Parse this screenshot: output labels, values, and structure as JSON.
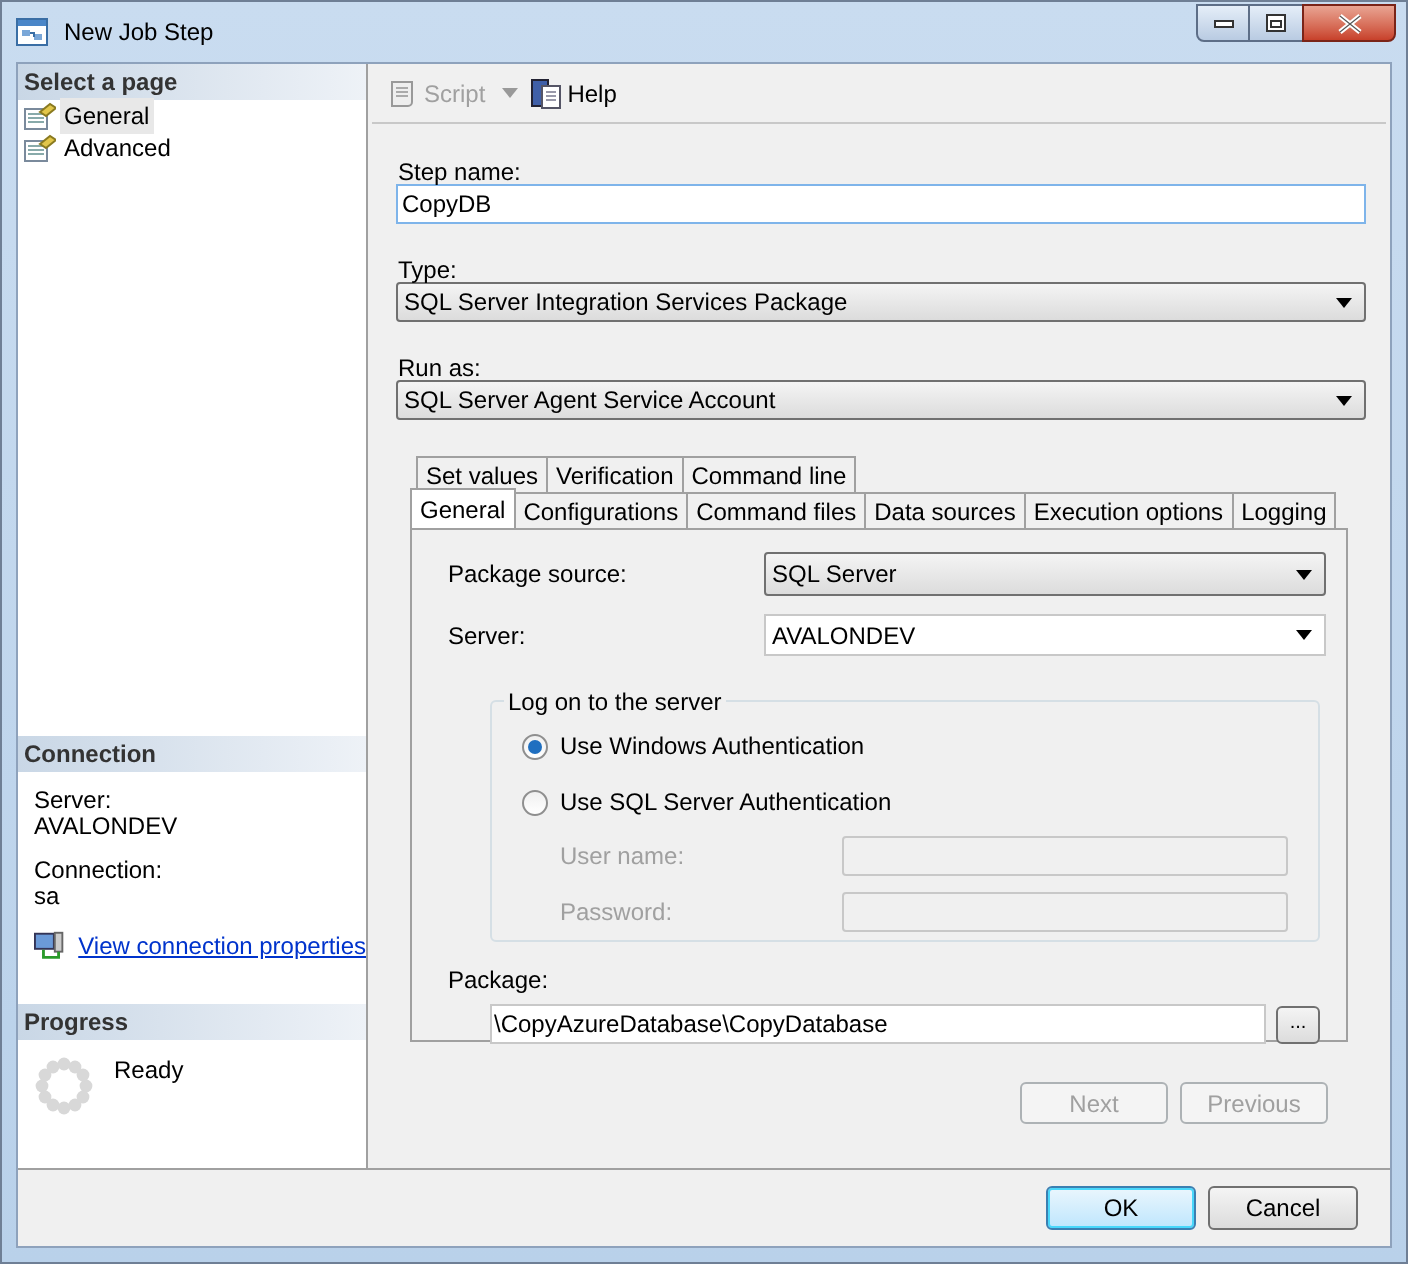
{
  "window": {
    "title": "New Job Step"
  },
  "sidebar": {
    "select_page": {
      "header": "Select a page",
      "items": [
        {
          "label": "General",
          "selected": true
        },
        {
          "label": "Advanced",
          "selected": false
        }
      ]
    },
    "connection": {
      "header": "Connection",
      "fields": [
        {
          "label": "Server:",
          "value": "AVALONDEV"
        },
        {
          "label": "Connection:",
          "value": "sa"
        }
      ],
      "link": "View connection properties"
    },
    "progress": {
      "header": "Progress",
      "status": "Ready"
    }
  },
  "toolbar": [
    {
      "label": "Script",
      "kind": "dropdown",
      "disabled": true
    },
    {
      "label": "Help",
      "kind": "button",
      "disabled": false
    }
  ],
  "form": {
    "step_name": {
      "label": "Step name:",
      "value": "CopyDB"
    },
    "type": {
      "label": "Type:",
      "value": "SQL Server Integration Services Package"
    },
    "run_as": {
      "label": "Run as:",
      "value": "SQL Server Agent Service Account"
    }
  },
  "tabs": [
    [
      {
        "label": "Set values",
        "selected": false
      },
      {
        "label": "Verification",
        "selected": false
      },
      {
        "label": "Command line",
        "selected": false
      }
    ],
    [
      {
        "label": "General",
        "selected": true
      },
      {
        "label": "Configurations",
        "selected": false
      },
      {
        "label": "Command files",
        "selected": false
      },
      {
        "label": "Data sources",
        "selected": false
      },
      {
        "label": "Execution options",
        "selected": false
      },
      {
        "label": "Logging",
        "selected": false
      }
    ]
  ],
  "general_tab": {
    "package_source": {
      "label": "Package source:",
      "value": "SQL Server"
    },
    "server": {
      "label": "Server:",
      "value": "AVALONDEV"
    },
    "logon": {
      "title": "Log on to the server",
      "options": [
        {
          "label": "Use Windows Authentication",
          "selected": true
        },
        {
          "label": "Use SQL Server Authentication",
          "selected": false
        }
      ],
      "credentials": [
        {
          "label": "User name:",
          "disabled": true
        },
        {
          "label": "Password:",
          "disabled": true
        }
      ]
    },
    "package": {
      "label": "Package:",
      "value": "\\CopyAzureDatabase\\CopyDatabase",
      "browse": "..."
    }
  },
  "nav_buttons": [
    {
      "label": "Next",
      "disabled": true
    },
    {
      "label": "Previous",
      "disabled": true
    }
  ],
  "dialog_buttons": [
    {
      "label": "OK",
      "default": true
    },
    {
      "label": "Cancel",
      "default": false
    }
  ]
}
